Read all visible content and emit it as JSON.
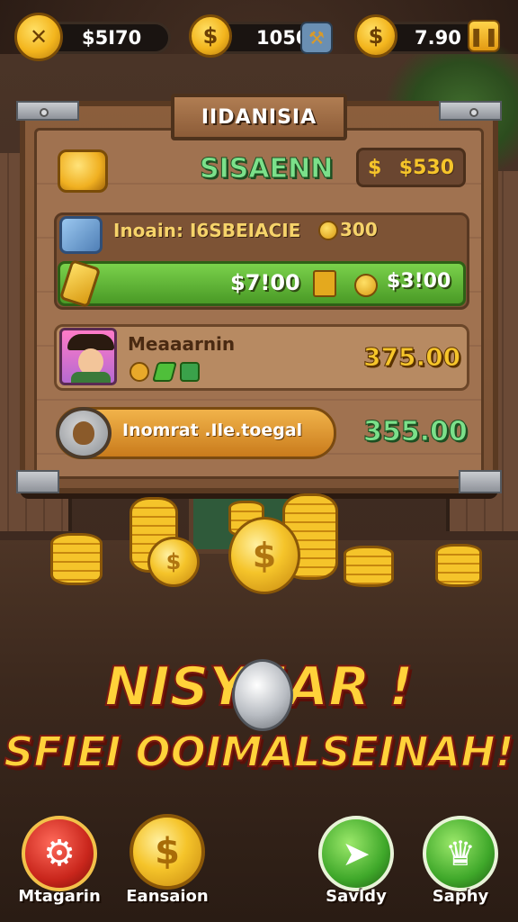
{
  "topbar": {
    "res1": {
      "icon": "crossed-tools-icon",
      "value": "$5I70"
    },
    "res2": {
      "icon": "dollar-coin-icon",
      "value": "1050",
      "action_icon": "hammer-icon"
    },
    "res3": {
      "icon": "coin-bag-icon",
      "value": "7.90",
      "action_icon": "pause-icon"
    }
  },
  "panel": {
    "sign_title": "IIDANISIA",
    "row1": {
      "icon": "coin-stack-icon",
      "title": "SISAENN",
      "currency": "$",
      "price": "$530"
    },
    "row2": {
      "icon": "tool-icon",
      "label": "Inoain: I6SBEIACIE",
      "cost": "300",
      "bar_left": "$7!00",
      "bar_right": "$3!00"
    },
    "row3": {
      "icon": "cowboy-avatar",
      "name": "Meaaarnin",
      "price": "375.00"
    },
    "row4": {
      "icon": "money-bag-icon",
      "label": "Inomrat .Ile.toegal",
      "price": "355.00"
    }
  },
  "headline": {
    "line1": "NISY  IAR !",
    "line2": "SFIEI OOIMALSEINAH!"
  },
  "bottom_nav": [
    {
      "label": "Mtagarin",
      "icon": "gear-icon",
      "color": "#d8332a"
    },
    {
      "label": "Eansaion",
      "icon": "gold-coin-icon",
      "color": "#f5c42a"
    },
    {
      "label": "Savldy",
      "icon": "paper-plane-icon",
      "color": "#3fa82a"
    },
    {
      "label": "Saphy",
      "icon": "crown-icon",
      "color": "#3fa82a"
    }
  ],
  "colors": {
    "gold": "#f6c52a",
    "green_text": "#7be08a",
    "wood": "#8b5e3c"
  }
}
